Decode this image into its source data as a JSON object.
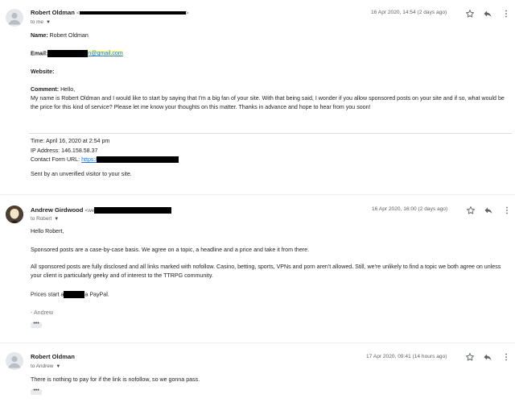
{
  "messages": [
    {
      "sender": "Robert Oldman",
      "email_prefix": "<",
      "email_suffix": ">",
      "to": "to me",
      "date": "16 Apr 2020, 14:54 (2 days ago)",
      "name_label": "Name:",
      "name_value": "Robert Oldman",
      "email_label": "Email:",
      "email_visible": "n@gmail.com",
      "website_label": "Website:",
      "comment_label": "Comment:",
      "comment_first": "Hello,",
      "comment_body": "My name is Robert Oldman and I would like to start by saying that I'm a big fan of your site. With that being said, I wonder if you allow sponsored posts on your site and if so, what would be the price for this kind of service? Please let me know your thoughts on this matter. Thanks in advance and hope to hear from you soon!",
      "time_line": "Time: April 16, 2020 at 2:54 pm",
      "ip_line": "IP Address: 146.158.58.37",
      "contact_label": "Contact Form URL:",
      "contact_link": "https:/",
      "sent_by": "Sent by an unverified visitor to your site."
    },
    {
      "sender": "Andrew Girdwood",
      "email_prefix": "<we",
      "to": "to Robert",
      "date": "16 Apr 2020, 16:00 (2 days ago)",
      "greeting": "Hello Robert,",
      "p1": "Sponsored posts are a case-by-case basis. We agree on a topic, a headline and a price and take it from there.",
      "p2": "All sponsored posts are fully disclosed and all links marked with nofollow. Casino, betting, sports, VPNs and porn aren't allowed. Still, we're unlikely to find a topic we both agree on unless your client is particularly geeky and of interest to the TTRPG community.",
      "p3_start": "Prices start a",
      "p3_end": "a PayPal.",
      "signoff": "- Andrew"
    },
    {
      "sender": "Robert Oldman",
      "to": "to Andrew",
      "date": "17 Apr 2020, 09:41 (14 hours ago)",
      "body": "There is nothing to pay for if the link is nofollow, so we gonna pass."
    }
  ],
  "icons": [
    "person-icon",
    "star-icon",
    "reply-icon",
    "more-vert-icon",
    "chevron-down-icon",
    "ellipsis-icon"
  ],
  "ellipsis": "•••"
}
